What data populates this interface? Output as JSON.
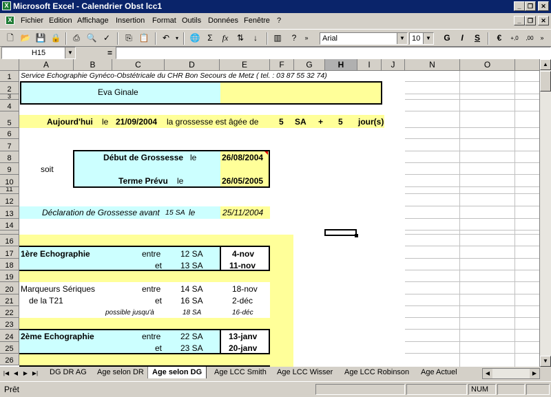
{
  "window": {
    "title": "Microsoft Excel - Calendrier Obst lcc1"
  },
  "menu": {
    "items": [
      "Fichier",
      "Edition",
      "Affichage",
      "Insertion",
      "Format",
      "Outils",
      "Données",
      "Fenêtre",
      "?"
    ]
  },
  "toolbar": {
    "font": "Arial",
    "size": "10",
    "bold": "G",
    "italic": "I",
    "underline": "S",
    "sigma": "Σ",
    "fx": "f",
    "euro": "€"
  },
  "formula_bar": {
    "name_box": "H15",
    "equals": "=",
    "content": ""
  },
  "columns": [
    "A",
    "B",
    "C",
    "D",
    "E",
    "F",
    "G",
    "H",
    "I",
    "J",
    "N",
    "O"
  ],
  "rows": [
    "1",
    "2",
    "3",
    "4",
    "5",
    "6",
    "7",
    "8",
    "9",
    "10",
    "11",
    "12",
    "13",
    "14",
    "16",
    "17",
    "18",
    "19",
    "20",
    "21",
    "22",
    "23",
    "24",
    "25",
    "26"
  ],
  "sheet": {
    "header_note": "Service Echographie Gynéco-Obstétricale du CHR Bon Secours de Metz  ( tel. : 03 87 55 32 74)",
    "patient_name": "Eva Ginale",
    "today_label": "Aujourd'hui",
    "today_le": "le",
    "today_date": "21/09/2004",
    "age_text": "la grossesse est âgée de",
    "weeks": "5",
    "sa": "SA",
    "plus": "+",
    "days": "5",
    "days_label": "jour(s)",
    "soit": "soit",
    "debut_label": "Début de Grossesse",
    "debut_le": "le",
    "debut_date": "26/08/2004",
    "terme_label": "Terme Prévu",
    "terme_le": "le",
    "terme_date": "26/05/2005",
    "declaration_label": "Déclaration de Grossesse avant",
    "declaration_sa": "15 SA",
    "declaration_le": "le",
    "declaration_date": "25/11/2004",
    "echo1_label": "1ère Echographie",
    "echo1_entre": "entre",
    "echo1_sa1": "12 SA",
    "echo1_date1": "4-nov",
    "echo1_et": "et",
    "echo1_sa2": "13 SA",
    "echo1_date2": "11-nov",
    "marq_label1": "Marqueurs Sériques",
    "marq_label2": "de la T21",
    "marq_entre": "entre",
    "marq_sa1": "14 SA",
    "marq_date1": "18-nov",
    "marq_et": "et",
    "marq_sa2": "16 SA",
    "marq_date2": "2-déc",
    "possible_label": "possible jusqu'à",
    "possible_sa": "18 SA",
    "possible_date": "16-déc",
    "echo2_label": "2ème Echographie",
    "echo2_entre": "entre",
    "echo2_sa1": "22 SA",
    "echo2_date1": "13-janv",
    "echo2_et": "et",
    "echo2_sa2": "23 SA",
    "echo2_date2": "20-janv"
  },
  "tabs": [
    "DG DR AG",
    "Age selon DR",
    "Age selon DG",
    "Age LCC Smith",
    "Age LCC Wisser",
    "Age LCC Robinson",
    "Age Actuel"
  ],
  "active_tab": "Age selon DG",
  "status": {
    "ready": "Prêt",
    "num": "NUM"
  },
  "colors": {
    "yellow": "#ffff99",
    "cyan": "#ccffff",
    "titlebar": "#0a246a"
  }
}
